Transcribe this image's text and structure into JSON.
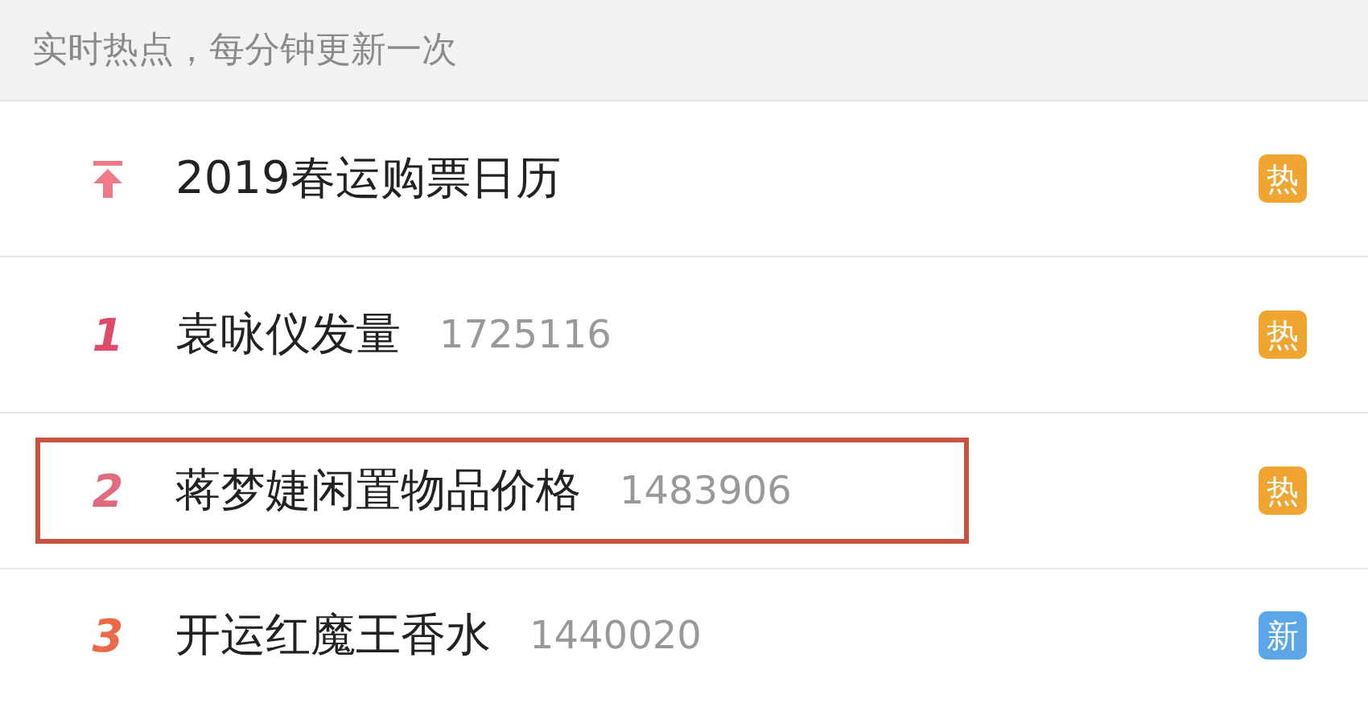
{
  "header": {
    "text": "实时热点，每分钟更新一次"
  },
  "rows": [
    {
      "kind": "pinned",
      "title": "2019春运购票日历",
      "badge": {
        "text": "热",
        "color": "#f0a531"
      },
      "highlighted": false
    },
    {
      "kind": "ranked",
      "rank": "1",
      "color": "#e04a66",
      "title": "袁咏仪发量",
      "count": "1725116",
      "badge": {
        "text": "热",
        "color": "#f0a531"
      },
      "highlighted": false
    },
    {
      "kind": "ranked",
      "rank": "2",
      "color": "#e06a7e",
      "title": "蒋梦婕闲置物品价格",
      "count": "1483906",
      "badge": {
        "text": "热",
        "color": "#f0a531"
      },
      "highlighted": true
    },
    {
      "kind": "ranked",
      "rank": "3",
      "color": "#ec6a48",
      "title": "开运红魔王香水",
      "count": "1440020",
      "badge": {
        "text": "新",
        "color": "#5ba6e8"
      },
      "highlighted": false
    }
  ]
}
